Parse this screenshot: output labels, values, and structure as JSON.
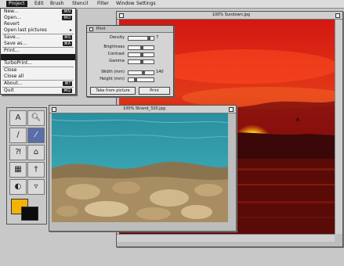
{
  "menubar": {
    "items": [
      {
        "label": "Project",
        "active": true
      },
      {
        "label": "Edit"
      },
      {
        "label": "Brush"
      },
      {
        "label": "Stencil"
      },
      {
        "label": "Filter"
      },
      {
        "label": "Window"
      },
      {
        "label": "Settings"
      }
    ]
  },
  "file_menu": {
    "items": [
      {
        "label": "New...",
        "shortcut": "⌘N"
      },
      {
        "label": "Open...",
        "shortcut": "⌘O"
      },
      {
        "label": "Revert"
      },
      {
        "label": "Open last pictures",
        "submenu": true
      },
      {
        "separator": true
      },
      {
        "label": "Save...",
        "shortcut": "⌘S"
      },
      {
        "label": "Save as...",
        "shortcut": "⌘A"
      },
      {
        "separator": true
      },
      {
        "label": "Print..."
      },
      {
        "label": "",
        "selected": true
      },
      {
        "label": "TurboPrint..."
      },
      {
        "separator": true
      },
      {
        "label": "Close"
      },
      {
        "label": "Close all"
      },
      {
        "separator": true
      },
      {
        "label": "About...",
        "shortcut": "⌘?"
      },
      {
        "separator": true
      },
      {
        "label": "Quit",
        "shortcut": "⌘Q"
      }
    ]
  },
  "sunset_window": {
    "title": "100% Sundown.jpg"
  },
  "beach_window": {
    "title": "100% Strand_320.jpg"
  },
  "print_dialog": {
    "title": "Print",
    "fields": [
      {
        "label": "Density",
        "value": "7",
        "level": 0.85
      },
      {
        "label": "Brightness",
        "value": "",
        "level": 0.55
      },
      {
        "label": "Contrast",
        "value": "",
        "level": 0.55
      },
      {
        "label": "Gamma",
        "value": "",
        "level": 0.55
      },
      {
        "label": "Width (mm)",
        "value": "140",
        "level": 0.6
      },
      {
        "label": "Height (mm)",
        "value": "",
        "level": 0.25
      }
    ],
    "take_from_picture_label": "Take from picture",
    "print_button_label": "Print"
  },
  "toolbox": {
    "tools": [
      "text-tool",
      "zoom-tool",
      "pencil-tool",
      "brush-tool",
      "airbrush-tool",
      "stamp-tool",
      "grid-tool",
      "eyedropper-tool",
      "color-picker-tool",
      "fill-tool"
    ],
    "foreground_color": "#f2b400",
    "background_color": "#0c0c0c"
  }
}
